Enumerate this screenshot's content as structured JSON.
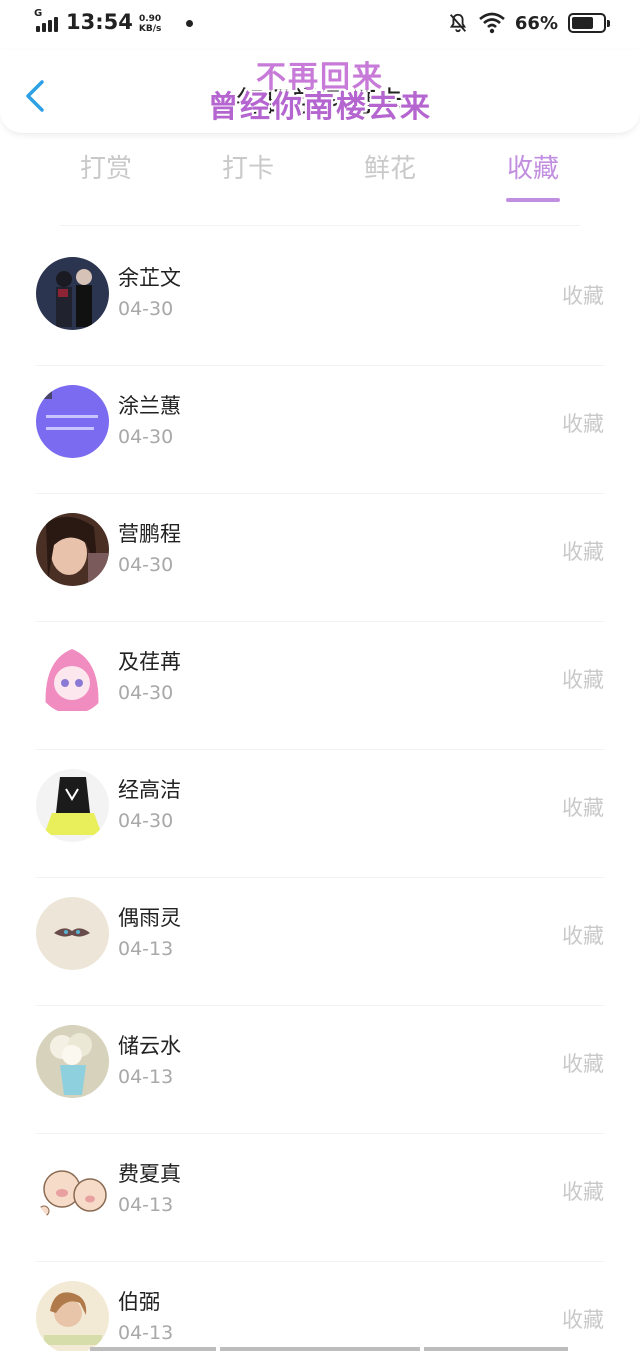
{
  "status_bar": {
    "network_type": "G",
    "time": "13:54",
    "net_speed_value": "0.90",
    "net_speed_unit": "KB/s",
    "battery_percent": "66%",
    "icons": [
      "signal-icon",
      "bell-off-icon",
      "wifi-icon",
      "battery-icon"
    ]
  },
  "header": {
    "back_icon": "chevron-left-icon",
    "title": "每日学习打卡",
    "overlay_line1": "不再回来",
    "overlay_line2": "曾经你南楼去来"
  },
  "tabs": [
    {
      "label": "打赏",
      "active": false
    },
    {
      "label": "打卡",
      "active": false
    },
    {
      "label": "鲜花",
      "active": false
    },
    {
      "label": "收藏",
      "active": true
    }
  ],
  "list": [
    {
      "name": "余芷文",
      "date": "04-30",
      "action": "收藏"
    },
    {
      "name": "涂兰蕙",
      "date": "04-30",
      "action": "收藏"
    },
    {
      "name": "营鹏程",
      "date": "04-30",
      "action": "收藏"
    },
    {
      "name": "及荏苒",
      "date": "04-30",
      "action": "收藏"
    },
    {
      "name": "经高洁",
      "date": "04-30",
      "action": "收藏"
    },
    {
      "name": "偶雨灵",
      "date": "04-13",
      "action": "收藏"
    },
    {
      "name": "储云水",
      "date": "04-13",
      "action": "收藏"
    },
    {
      "name": "费夏真",
      "date": "04-13",
      "action": "收藏"
    },
    {
      "name": "伯弼",
      "date": "04-13",
      "action": "收藏"
    }
  ],
  "colors": {
    "accent": "#c18ee0",
    "tab_inactive": "#c9c9c9",
    "back_icon": "#2f9fe6"
  }
}
